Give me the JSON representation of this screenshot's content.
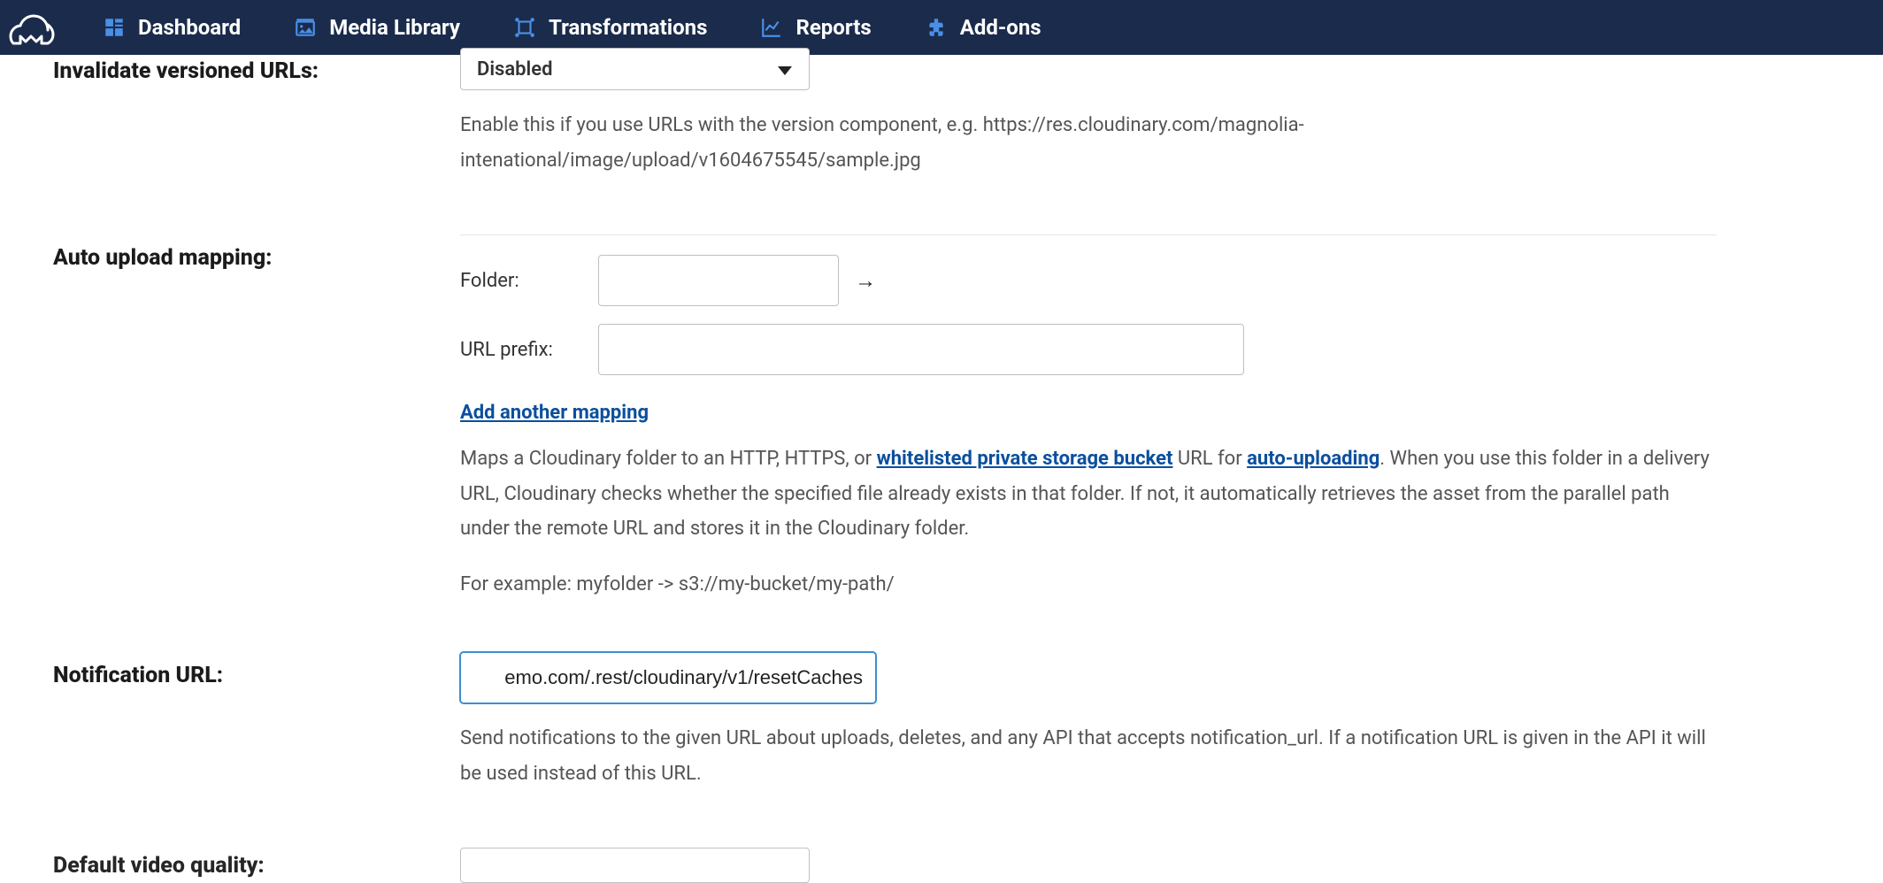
{
  "nav": {
    "items": [
      {
        "label": "Dashboard"
      },
      {
        "label": "Media Library"
      },
      {
        "label": "Transformations"
      },
      {
        "label": "Reports"
      },
      {
        "label": "Add-ons"
      }
    ]
  },
  "sections": {
    "invalidate": {
      "label": "Invalidate versioned URLs:",
      "select_value": "Disabled",
      "helper": "Enable this if you use URLs with the version component, e.g. https://res.cloudinary.com/magnolia-intenational/image/upload/v1604675545/sample.jpg"
    },
    "auto_upload": {
      "label": "Auto upload mapping:",
      "folder_label": "Folder:",
      "folder_value": "",
      "url_prefix_label": "URL prefix:",
      "url_prefix_value": "",
      "add_mapping": "Add another mapping",
      "helper_pre": "Maps a Cloudinary folder to an HTTP, HTTPS, or ",
      "helper_link1": "whitelisted private storage bucket",
      "helper_mid": " URL for ",
      "helper_link2": "auto-uploading",
      "helper_post": ". When you use this folder in a delivery URL, Cloudinary checks whether the specified file already exists in that folder. If not, it automatically retrieves the asset from the parallel path under the remote URL and stores it in the Cloudinary folder.",
      "example": "For example: myfolder -> s3://my-bucket/my-path/"
    },
    "notification": {
      "label": "Notification URL:",
      "value": "emo.com/.rest/cloudinary/v1/resetCaches",
      "helper": "Send notifications to the given URL about uploads, deletes, and any API that accepts notification_url. If a notification URL is given in the API it will be used instead of this URL."
    },
    "default_video_quality": {
      "label": "Default video quality:"
    }
  }
}
